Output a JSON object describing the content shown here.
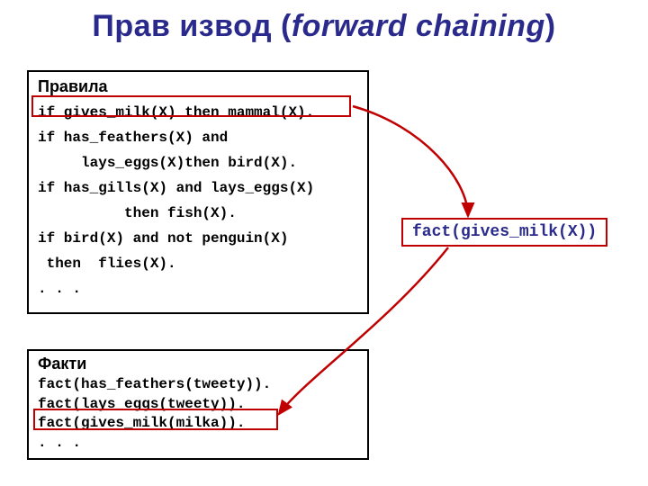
{
  "title": {
    "prefix": "Прав извод (",
    "italic": "forward chaining",
    "suffix": ")"
  },
  "rules": {
    "heading": "Правила",
    "line1": "if gives_milk(X) then mammal(X).",
    "line2": "if has_feathers(X) and",
    "line3": "     lays_eggs(X)then bird(X).",
    "line4": "if has_gills(X) and lays_eggs(X)",
    "line5": "          then fish(X).",
    "line6": "if bird(X) and not penguin(X)",
    "line7": " then  flies(X).",
    "line8": ". . ."
  },
  "facts": {
    "heading": "Факти",
    "f1": "fact(has_feathers(tweety)).",
    "f2": "fact(lays_eggs(tweety)).",
    "f3": "fact(gives_milk(milka)).",
    "f4": ". . ."
  },
  "result": {
    "text": "fact(gives_milk(X))"
  },
  "highlights": {
    "rule1_color": "#c00000",
    "fact3_color": "#c00000",
    "result_border": "#c00000"
  },
  "arrows": {
    "color": "#c00000",
    "arrow1": {
      "from": "rules.line1",
      "to": "result"
    },
    "arrow2": {
      "from": "result",
      "to": "facts.f3"
    }
  }
}
